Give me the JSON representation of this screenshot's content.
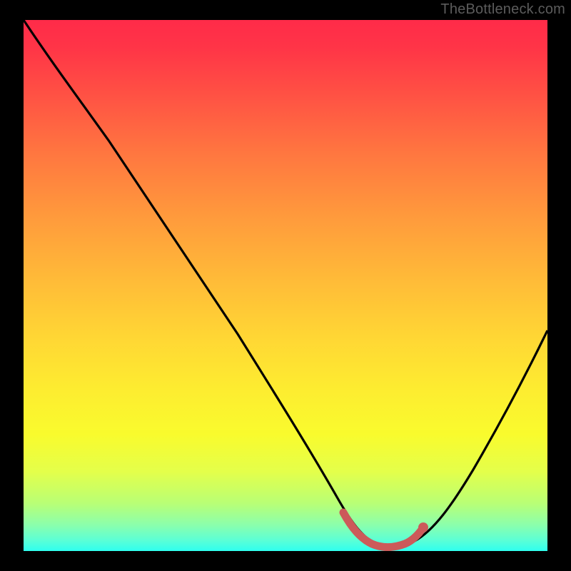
{
  "watermark": "TheBottleneck.com",
  "colors": {
    "frame": "#000000",
    "watermark_text": "#5c5c5c",
    "curve": "#000000",
    "marker": "#cc5a5a",
    "gradient_stops": [
      "#ff2b49",
      "#ff3447",
      "#ff5144",
      "#ff7640",
      "#ff9a3c",
      "#ffbb38",
      "#ffd734",
      "#fded30",
      "#f9fb2d",
      "#e4ff4a",
      "#b9ff75",
      "#8cffab",
      "#5bffd6",
      "#2fffef"
    ]
  },
  "chart_data": {
    "type": "line",
    "title": "",
    "xlabel": "",
    "ylabel": "",
    "xlim": [
      0,
      100
    ],
    "ylim": [
      0,
      100
    ],
    "series": [
      {
        "name": "bottleneck-curve",
        "x": [
          0,
          5,
          10,
          15,
          20,
          25,
          30,
          35,
          40,
          45,
          50,
          55,
          60,
          62,
          64,
          66,
          68,
          70,
          72,
          74,
          78,
          82,
          86,
          90,
          94,
          98,
          100
        ],
        "y": [
          100,
          96,
          91,
          85,
          78,
          71,
          63,
          55,
          47,
          39,
          30,
          21,
          12,
          8,
          5,
          3,
          2,
          2,
          2,
          3,
          7,
          13,
          21,
          29,
          38,
          47,
          52
        ]
      }
    ],
    "markers": [
      {
        "name": "optimal-range-start",
        "x": 62,
        "y": 6
      },
      {
        "name": "optimal-range-end",
        "x": 75,
        "y": 4
      }
    ],
    "annotations": []
  }
}
